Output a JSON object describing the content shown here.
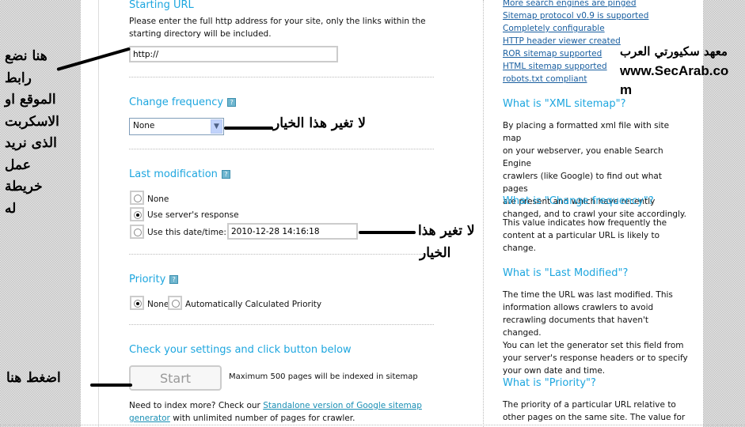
{
  "form": {
    "starting_url": {
      "heading": "Starting URL",
      "description_1": "Please enter the full http address for your site, only the links within the",
      "description_2": "starting directory will be included.",
      "value": "http://"
    },
    "change_frequency": {
      "heading": "Change frequency",
      "help": "?",
      "selected": "None"
    },
    "last_modification": {
      "heading": "Last modification",
      "help": "?",
      "options": [
        "None",
        "Use server's response",
        "Use this date/time:"
      ],
      "selected": "Use server's response",
      "date_value": "2010-12-28 14:16:18"
    },
    "priority": {
      "heading": "Priority",
      "help": "?",
      "options": [
        "None",
        "Automatically Calculated Priority"
      ],
      "selected": "None"
    },
    "submit": {
      "heading": "Check your settings and click button below",
      "button": "Start",
      "max_note": "Maximum 500 pages will be indexed in sitemap",
      "more_1": "Need to index more? Check our ",
      "link_1": "Standalone version of Google sitemap",
      "link_2": "generator",
      "more_2": " with unlimited number of pages for crawler."
    }
  },
  "sidebar": {
    "links": [
      "More search engines are pinged",
      "Sitemap protocol v0.9 is supported",
      "Completely configurable",
      "HTTP header viewer created",
      "ROR sitemap supported",
      "HTML sitemap supported",
      "robots.txt compliant"
    ],
    "faq": [
      {
        "q": "What is \"XML sitemap\"?",
        "a": [
          "By placing a formatted xml file with site map",
          "on your webserver, you enable Search Engine",
          "crawlers (like Google) to find out what pages",
          "are present and which have recently",
          "changed, and to crawl your site accordingly."
        ]
      },
      {
        "q": "What is \"Change frequency\"?",
        "a": [
          "This value indicates how frequently the",
          "content at a particular URL is likely to",
          "change."
        ]
      },
      {
        "q": "What is \"Last Modified\"?",
        "a": [
          "The time the URL was last modified. This",
          "information allows crawlers to avoid",
          "recrawling documents that haven't changed.",
          "You can let the generator set this field from",
          "your server's response headers or to specify",
          "your own date and time."
        ]
      },
      {
        "q": "What is \"Priority\"?",
        "a": [
          "The priority of a particular URL relative to",
          "other pages on the same site. The value for"
        ]
      }
    ]
  },
  "annotations": {
    "url_note": [
      "هنا نضع",
      "رابط",
      "الموقع او",
      "الاسكربت",
      "الذى نريد",
      "عمل",
      "خريطة",
      "له"
    ],
    "freq_note": "لا تغير هذا الخيار",
    "date_note_1": "لا تغير هذا",
    "date_note_2": "الخيار",
    "start_note": "اضغط هنا",
    "brand_1": "معهد سكيورتي العرب",
    "brand_2": "www.SecArab.co",
    "brand_3": "m"
  }
}
